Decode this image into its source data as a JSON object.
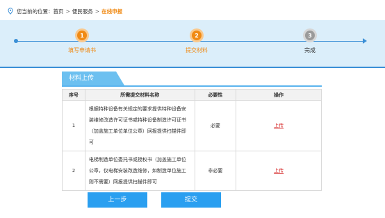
{
  "breadcrumb": {
    "prefix": "您当前的位置：",
    "home": "首页",
    "separator": ">",
    "section": "便民服务",
    "current": "在线申报"
  },
  "steps": [
    {
      "number": "1",
      "label": "填写申请书",
      "status": "done"
    },
    {
      "number": "2",
      "label": "提交材料",
      "status": "done"
    },
    {
      "number": "3",
      "label": "完成",
      "status": "todo"
    }
  ],
  "panel": {
    "title": "材料上传"
  },
  "table": {
    "headers": [
      "序号",
      "所需提交材料名称",
      "必要性",
      "操作"
    ],
    "rows": [
      {
        "index": "1",
        "name": "根据特种设备有关规定的要求提供特种设备安装维修改造许可证书或特种设备制造许可证书（加盖施工单位单位公章）网报提供扫描件即可",
        "requirement": "必要",
        "action": "上传"
      },
      {
        "index": "2",
        "name": "电梯制造单位委托书或授权书（加盖施工单位公章，仅电梯安装改造维修，如制造单位施工则不需要）网报提供扫描件即可",
        "requirement": "非必要",
        "action": "上传"
      }
    ]
  },
  "buttons": {
    "prev": "上一步",
    "submit": "提交"
  },
  "colors": {
    "accent_orange": "#f08a14",
    "accent_blue": "#2a9ff0",
    "link_red": "#d42020",
    "band_bg": "#dbeefa"
  }
}
